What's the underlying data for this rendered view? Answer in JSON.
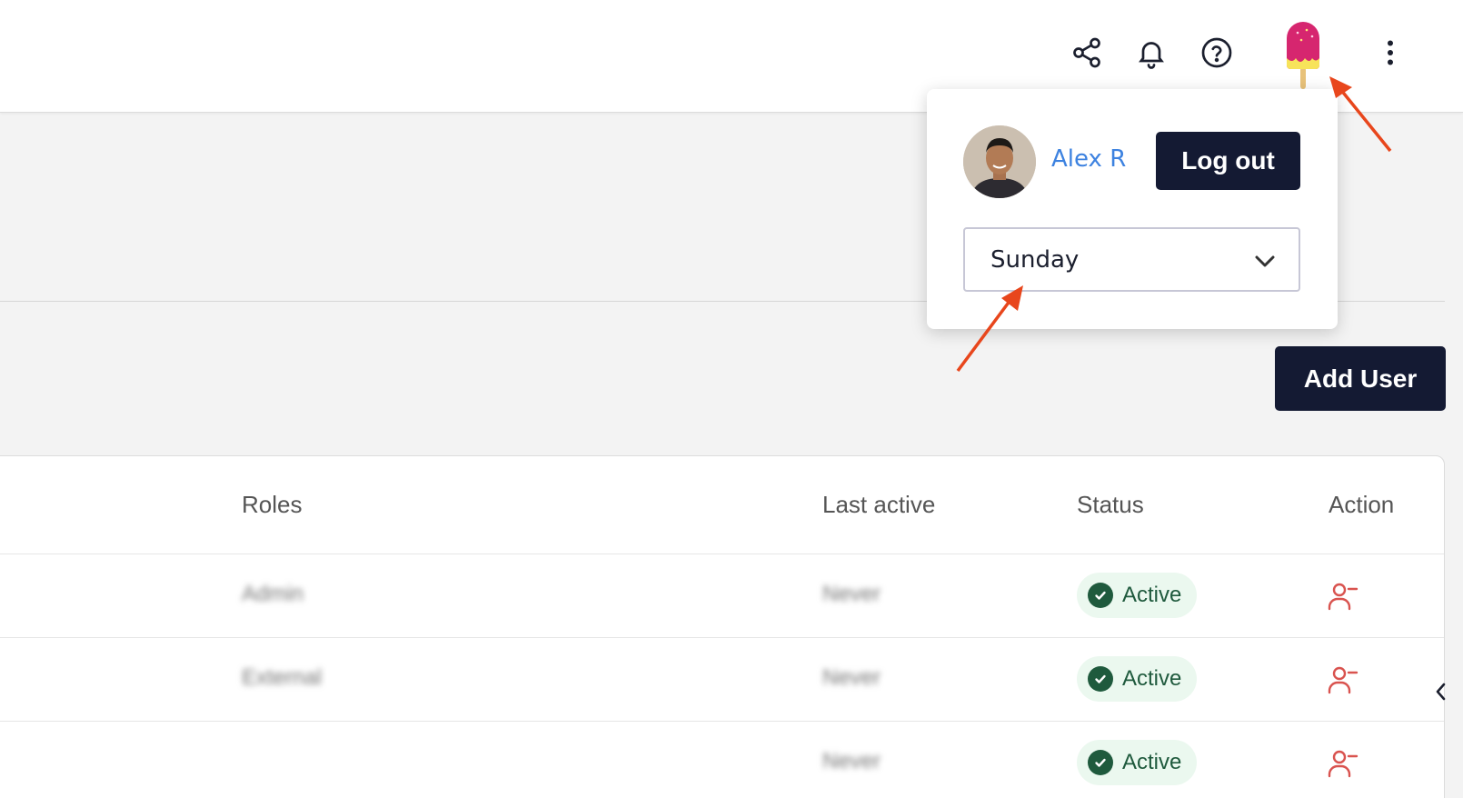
{
  "topbar": {
    "icons": [
      "share-icon",
      "bell-icon",
      "help-icon",
      "popsicle-avatar-icon",
      "more-vertical-icon"
    ]
  },
  "account_menu": {
    "user_name": "Alex R",
    "logout_label": "Log out",
    "day_select": {
      "value": "Sunday"
    }
  },
  "toolbar": {
    "add_user_label": "Add User"
  },
  "table": {
    "headers": {
      "roles": "Roles",
      "last_active": "Last active",
      "status": "Status",
      "action": "Action"
    },
    "rows": [
      {
        "role": "Admin",
        "last_active": "Never",
        "status": "Active"
      },
      {
        "role": "External",
        "last_active": "Never",
        "status": "Active"
      },
      {
        "role": "",
        "last_active": "Never",
        "status": "Active"
      }
    ]
  },
  "colors": {
    "primary_dark": "#141a33",
    "link_blue": "#3d82e0",
    "status_green": "#1f5a3d",
    "status_bg": "#ebf8ef",
    "danger_red": "#d9534f",
    "annotation_arrow": "#e8461c"
  }
}
